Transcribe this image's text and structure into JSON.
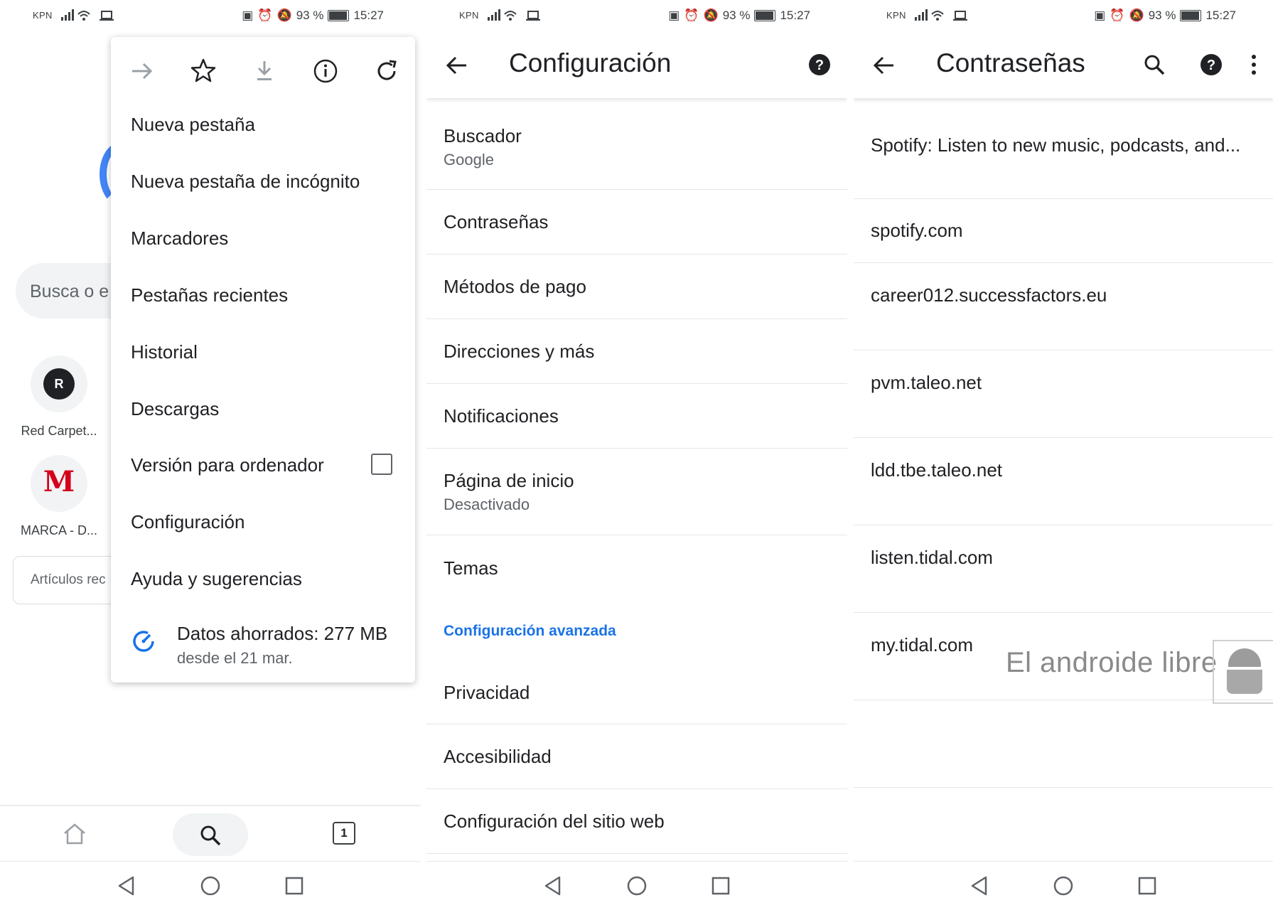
{
  "status_bar": {
    "carrier": "KPN",
    "battery": "93 %",
    "time": "15:27"
  },
  "browser_bg": {
    "search_placeholder": "Busca o e",
    "tiles": [
      {
        "initial": "R",
        "label": "Red Carpet..."
      },
      {
        "initial": "M",
        "label": "MARCA - D..."
      }
    ],
    "articles_label": "Artículos rec"
  },
  "menu": {
    "icons": [
      "forward-icon",
      "star-icon",
      "download-icon",
      "info-icon",
      "refresh-icon"
    ],
    "items": [
      "Nueva pestaña",
      "Nueva pestaña de incógnito",
      "Marcadores",
      "Pestañas recientes",
      "Historial",
      "Descargas",
      "Versión para ordenador",
      "Configuración",
      "Ayuda y sugerencias"
    ],
    "data_saved": "Datos ahorrados: 277 MB",
    "data_saved_since": "desde el 21 mar."
  },
  "bottom_nav": {
    "tab_count": "1"
  },
  "settings": {
    "title": "Configuración",
    "items": [
      {
        "title": "Buscador",
        "subtitle": "Google"
      },
      {
        "title": "Contraseñas"
      },
      {
        "title": "Métodos de pago"
      },
      {
        "title": "Direcciones y más"
      },
      {
        "title": "Notificaciones"
      },
      {
        "title": "Página de inicio",
        "subtitle": "Desactivado"
      },
      {
        "title": "Temas"
      }
    ],
    "advanced_header": "Configuración avanzada",
    "advanced_items": [
      "Privacidad",
      "Accesibilidad",
      "Configuración del sitio web"
    ]
  },
  "passwords": {
    "title": "Contraseñas",
    "items": [
      "Spotify: Listen to new music, podcasts, and...",
      "spotify.com",
      "career012.successfactors.eu",
      "pvm.taleo.net",
      "ldd.tbe.taleo.net",
      "listen.tidal.com",
      "my.tidal.com"
    ]
  },
  "watermark": "El androide libre",
  "colors": {
    "accent": "#1a73e8",
    "marca_red": "#d5001c",
    "text": "#202124",
    "secondary": "#5f6368"
  }
}
